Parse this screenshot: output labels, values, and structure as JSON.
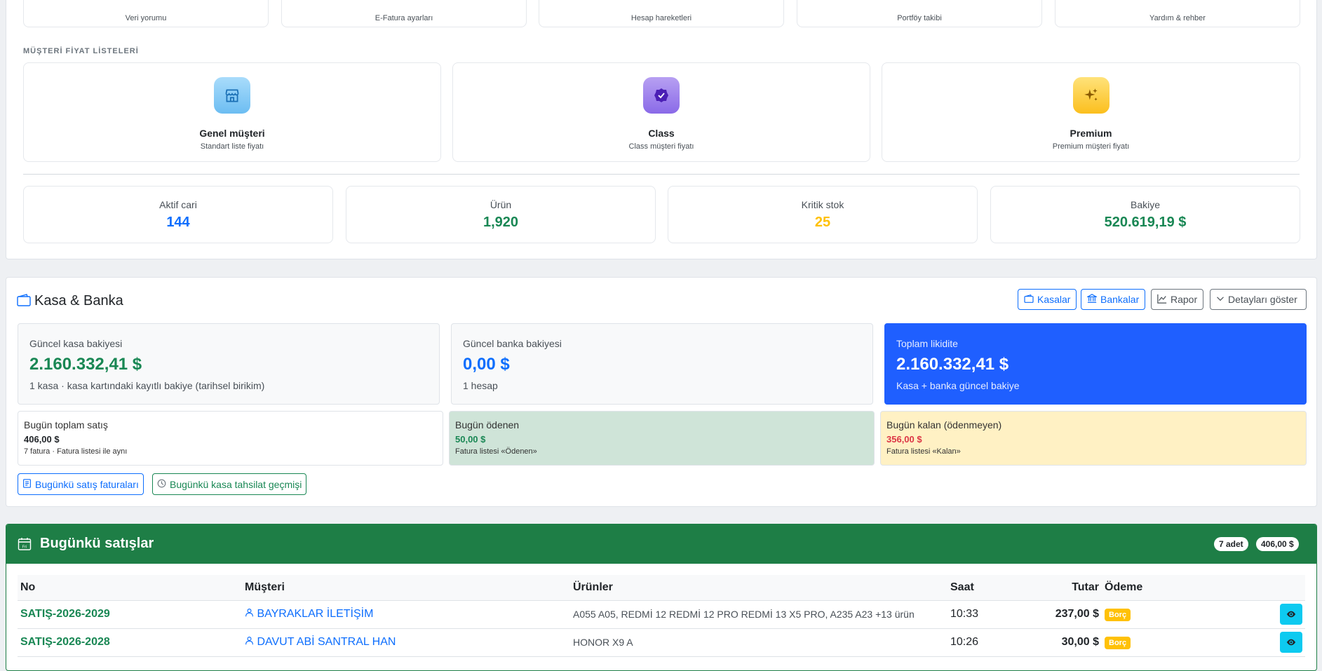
{
  "quick_cards": [
    {
      "sub": "Veri yorumu"
    },
    {
      "sub": "E-Fatura ayarları"
    },
    {
      "sub": "Hesap hareketleri"
    },
    {
      "sub": "Portföy takibi"
    },
    {
      "sub": "Yardım & rehber"
    }
  ],
  "price_lists": {
    "section_label": "MÜŞTERİ FİYAT LİSTELERİ",
    "items": [
      {
        "title": "Genel müşteri",
        "sub": "Standart liste fiyatı",
        "icon": "store-icon",
        "color": "#7dc4f5"
      },
      {
        "title": "Class",
        "sub": "Class müşteri fiyatı",
        "icon": "verified-badge-icon",
        "color": "#8a6ae8"
      },
      {
        "title": "Premium",
        "sub": "Premium müşteri fiyatı",
        "icon": "sparkles-icon",
        "color": "#ffc93d"
      }
    ]
  },
  "stats": [
    {
      "label": "Aktif cari",
      "value": "144",
      "color": "#0d6efd"
    },
    {
      "label": "Ürün",
      "value": "1,920",
      "color": "#198754"
    },
    {
      "label": "Kritik stok",
      "value": "25",
      "color": "#ffc107"
    },
    {
      "label": "Bakiye",
      "value": "520.619,19 $",
      "color": "#198754"
    }
  ],
  "kasa": {
    "title": "Kasa & Banka",
    "buttons": {
      "kasalar": "Kasalar",
      "bankalar": "Bankalar",
      "rapor": "Rapor",
      "detay": "Detayları göster"
    },
    "balances": [
      {
        "label": "Güncel kasa bakiyesi",
        "value": "2.160.332,41 $",
        "desc": "1 kasa · kasa kartındaki kayıtlı bakiye (tarihsel birikim)"
      },
      {
        "label": "Güncel banka bakiyesi",
        "value": "0,00 $",
        "desc": "1 hesap"
      },
      {
        "label": "Toplam likidite",
        "value": "2.160.332,41 $",
        "desc": "Kasa + banka güncel bakiye"
      }
    ],
    "today": [
      {
        "label": "Bugün toplam satış",
        "value": "406,00 $",
        "desc": "7 fatura · Fatura listesi ile aynı"
      },
      {
        "label": "Bugün ödenen",
        "value": "50,00 $",
        "desc": "Fatura listesi «Ödenen»"
      },
      {
        "label": "Bugün kalan (ödenmeyen)",
        "value": "356,00 $",
        "desc": "Fatura listesi «Kalan»"
      }
    ],
    "link_invoices": "Bugünkü satış faturaları",
    "link_history": "Bugünkü kasa tahsilat geçmişi"
  },
  "sales": {
    "title": "Bugünkü satışlar",
    "calendar_text": "Fri",
    "count_badge": "7 adet",
    "total_badge": "406,00 $",
    "headers": {
      "no": "No",
      "customer": "Müşteri",
      "products": "Ürünler",
      "time": "Saat",
      "amount": "Tutar",
      "payment": "Ödeme"
    },
    "rows": [
      {
        "no": "SATIŞ-2026-2029",
        "customer": "BAYRAKLAR İLETİŞİM",
        "products": "A055 A05, REDMİ 12 REDMİ 12 PRO REDMİ 13 X5 PRO, A235 A23 +13 ürün",
        "time": "10:33",
        "amount": "237,00 $",
        "payment": "Borç"
      },
      {
        "no": "SATIŞ-2026-2028",
        "customer": "DAVUT ABİ SANTRAL HAN",
        "products": "HONOR X9 A",
        "time": "10:26",
        "amount": "30,00 $",
        "payment": "Borç"
      }
    ]
  }
}
